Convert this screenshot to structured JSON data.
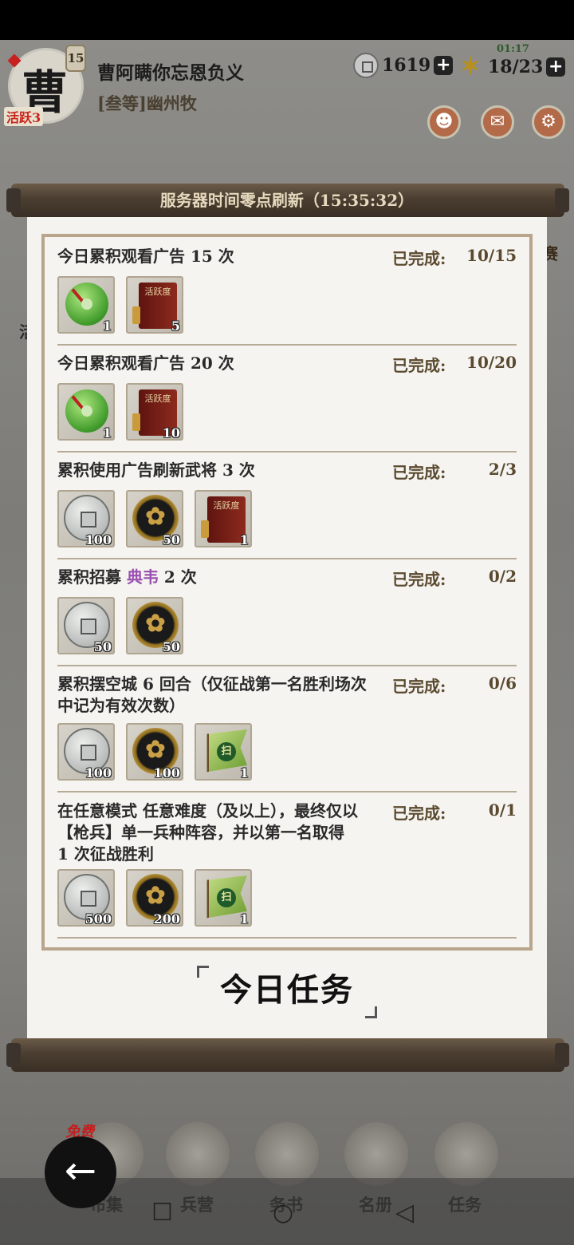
{
  "player": {
    "avatar_glyph": "曹",
    "level": "15",
    "activity": "活跃3",
    "name": "曹阿瞒你忘恩负义",
    "title": "[叁等]幽州牧"
  },
  "resources": {
    "coins": "1619",
    "time": "01:17",
    "stamina": "18/23"
  },
  "side": {
    "left": "活",
    "right": "赛"
  },
  "scroll": {
    "title": "服务器时间零点刷新（15:35:32）"
  },
  "tasks": [
    {
      "text": "今日累积观看广告 15 次",
      "done_label": "已完成:",
      "progress": "10/15",
      "rewards": [
        {
          "icon": "jade-disc-icon",
          "count": "1"
        },
        {
          "icon": "activity-book-icon",
          "count": "5"
        }
      ]
    },
    {
      "text": "今日累积观看广告 20 次",
      "done_label": "已完成:",
      "progress": "10/20",
      "rewards": [
        {
          "icon": "jade-disc-icon",
          "count": "1"
        },
        {
          "icon": "activity-book-icon",
          "count": "10"
        }
      ]
    },
    {
      "text": "累积使用广告刷新武将 3 次",
      "done_label": "已完成:",
      "progress": "2/3",
      "rewards": [
        {
          "icon": "silver-coin-icon",
          "count": "100"
        },
        {
          "icon": "gold-token-icon",
          "count": "50"
        },
        {
          "icon": "activity-book-icon",
          "count": "1"
        }
      ]
    },
    {
      "text_a": "累积招募 ",
      "text_hl": "典韦",
      "text_b": " 2 次",
      "done_label": "已完成:",
      "progress": "0/2",
      "rewards": [
        {
          "icon": "silver-coin-icon",
          "count": "50"
        },
        {
          "icon": "gold-token-icon",
          "count": "50"
        }
      ]
    },
    {
      "text": "累积摆空城 6 回合（仅征战第一名胜利场次中记为有效次数）",
      "done_label": "已完成:",
      "progress": "0/6",
      "rewards": [
        {
          "icon": "silver-coin-icon",
          "count": "100"
        },
        {
          "icon": "gold-token-icon",
          "count": "100"
        },
        {
          "icon": "flag-icon",
          "count": "1"
        }
      ]
    },
    {
      "text": "在任意模式 任意难度（及以上），最终仅以【枪兵】单一兵种阵容，并以第一名取得 1 次征战胜利",
      "done_label": "已完成:",
      "progress": "0/1",
      "rewards": [
        {
          "icon": "silver-coin-icon",
          "count": "500"
        },
        {
          "icon": "gold-token-icon",
          "count": "200"
        },
        {
          "icon": "flag-icon",
          "count": "1"
        }
      ]
    }
  ],
  "book_text": "活跃度",
  "seal": "今日任务",
  "nav": {
    "free": "免费",
    "items": [
      "布集",
      "兵营",
      "",
      "名册",
      "任务"
    ],
    "mid_label": "务书"
  }
}
